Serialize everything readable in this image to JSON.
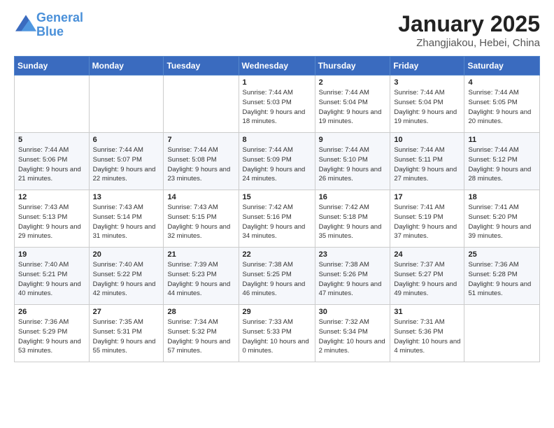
{
  "header": {
    "logo_line1": "General",
    "logo_line2": "Blue",
    "month": "January 2025",
    "location": "Zhangjiakou, Hebei, China"
  },
  "days_of_week": [
    "Sunday",
    "Monday",
    "Tuesday",
    "Wednesday",
    "Thursday",
    "Friday",
    "Saturday"
  ],
  "weeks": [
    [
      {
        "day": "",
        "sunrise": "",
        "sunset": "",
        "daylight": ""
      },
      {
        "day": "",
        "sunrise": "",
        "sunset": "",
        "daylight": ""
      },
      {
        "day": "",
        "sunrise": "",
        "sunset": "",
        "daylight": ""
      },
      {
        "day": "1",
        "sunrise": "Sunrise: 7:44 AM",
        "sunset": "Sunset: 5:03 PM",
        "daylight": "Daylight: 9 hours and 18 minutes."
      },
      {
        "day": "2",
        "sunrise": "Sunrise: 7:44 AM",
        "sunset": "Sunset: 5:04 PM",
        "daylight": "Daylight: 9 hours and 19 minutes."
      },
      {
        "day": "3",
        "sunrise": "Sunrise: 7:44 AM",
        "sunset": "Sunset: 5:04 PM",
        "daylight": "Daylight: 9 hours and 19 minutes."
      },
      {
        "day": "4",
        "sunrise": "Sunrise: 7:44 AM",
        "sunset": "Sunset: 5:05 PM",
        "daylight": "Daylight: 9 hours and 20 minutes."
      }
    ],
    [
      {
        "day": "5",
        "sunrise": "Sunrise: 7:44 AM",
        "sunset": "Sunset: 5:06 PM",
        "daylight": "Daylight: 9 hours and 21 minutes."
      },
      {
        "day": "6",
        "sunrise": "Sunrise: 7:44 AM",
        "sunset": "Sunset: 5:07 PM",
        "daylight": "Daylight: 9 hours and 22 minutes."
      },
      {
        "day": "7",
        "sunrise": "Sunrise: 7:44 AM",
        "sunset": "Sunset: 5:08 PM",
        "daylight": "Daylight: 9 hours and 23 minutes."
      },
      {
        "day": "8",
        "sunrise": "Sunrise: 7:44 AM",
        "sunset": "Sunset: 5:09 PM",
        "daylight": "Daylight: 9 hours and 24 minutes."
      },
      {
        "day": "9",
        "sunrise": "Sunrise: 7:44 AM",
        "sunset": "Sunset: 5:10 PM",
        "daylight": "Daylight: 9 hours and 26 minutes."
      },
      {
        "day": "10",
        "sunrise": "Sunrise: 7:44 AM",
        "sunset": "Sunset: 5:11 PM",
        "daylight": "Daylight: 9 hours and 27 minutes."
      },
      {
        "day": "11",
        "sunrise": "Sunrise: 7:44 AM",
        "sunset": "Sunset: 5:12 PM",
        "daylight": "Daylight: 9 hours and 28 minutes."
      }
    ],
    [
      {
        "day": "12",
        "sunrise": "Sunrise: 7:43 AM",
        "sunset": "Sunset: 5:13 PM",
        "daylight": "Daylight: 9 hours and 29 minutes."
      },
      {
        "day": "13",
        "sunrise": "Sunrise: 7:43 AM",
        "sunset": "Sunset: 5:14 PM",
        "daylight": "Daylight: 9 hours and 31 minutes."
      },
      {
        "day": "14",
        "sunrise": "Sunrise: 7:43 AM",
        "sunset": "Sunset: 5:15 PM",
        "daylight": "Daylight: 9 hours and 32 minutes."
      },
      {
        "day": "15",
        "sunrise": "Sunrise: 7:42 AM",
        "sunset": "Sunset: 5:16 PM",
        "daylight": "Daylight: 9 hours and 34 minutes."
      },
      {
        "day": "16",
        "sunrise": "Sunrise: 7:42 AM",
        "sunset": "Sunset: 5:18 PM",
        "daylight": "Daylight: 9 hours and 35 minutes."
      },
      {
        "day": "17",
        "sunrise": "Sunrise: 7:41 AM",
        "sunset": "Sunset: 5:19 PM",
        "daylight": "Daylight: 9 hours and 37 minutes."
      },
      {
        "day": "18",
        "sunrise": "Sunrise: 7:41 AM",
        "sunset": "Sunset: 5:20 PM",
        "daylight": "Daylight: 9 hours and 39 minutes."
      }
    ],
    [
      {
        "day": "19",
        "sunrise": "Sunrise: 7:40 AM",
        "sunset": "Sunset: 5:21 PM",
        "daylight": "Daylight: 9 hours and 40 minutes."
      },
      {
        "day": "20",
        "sunrise": "Sunrise: 7:40 AM",
        "sunset": "Sunset: 5:22 PM",
        "daylight": "Daylight: 9 hours and 42 minutes."
      },
      {
        "day": "21",
        "sunrise": "Sunrise: 7:39 AM",
        "sunset": "Sunset: 5:23 PM",
        "daylight": "Daylight: 9 hours and 44 minutes."
      },
      {
        "day": "22",
        "sunrise": "Sunrise: 7:38 AM",
        "sunset": "Sunset: 5:25 PM",
        "daylight": "Daylight: 9 hours and 46 minutes."
      },
      {
        "day": "23",
        "sunrise": "Sunrise: 7:38 AM",
        "sunset": "Sunset: 5:26 PM",
        "daylight": "Daylight: 9 hours and 47 minutes."
      },
      {
        "day": "24",
        "sunrise": "Sunrise: 7:37 AM",
        "sunset": "Sunset: 5:27 PM",
        "daylight": "Daylight: 9 hours and 49 minutes."
      },
      {
        "day": "25",
        "sunrise": "Sunrise: 7:36 AM",
        "sunset": "Sunset: 5:28 PM",
        "daylight": "Daylight: 9 hours and 51 minutes."
      }
    ],
    [
      {
        "day": "26",
        "sunrise": "Sunrise: 7:36 AM",
        "sunset": "Sunset: 5:29 PM",
        "daylight": "Daylight: 9 hours and 53 minutes."
      },
      {
        "day": "27",
        "sunrise": "Sunrise: 7:35 AM",
        "sunset": "Sunset: 5:31 PM",
        "daylight": "Daylight: 9 hours and 55 minutes."
      },
      {
        "day": "28",
        "sunrise": "Sunrise: 7:34 AM",
        "sunset": "Sunset: 5:32 PM",
        "daylight": "Daylight: 9 hours and 57 minutes."
      },
      {
        "day": "29",
        "sunrise": "Sunrise: 7:33 AM",
        "sunset": "Sunset: 5:33 PM",
        "daylight": "Daylight: 10 hours and 0 minutes."
      },
      {
        "day": "30",
        "sunrise": "Sunrise: 7:32 AM",
        "sunset": "Sunset: 5:34 PM",
        "daylight": "Daylight: 10 hours and 2 minutes."
      },
      {
        "day": "31",
        "sunrise": "Sunrise: 7:31 AM",
        "sunset": "Sunset: 5:36 PM",
        "daylight": "Daylight: 10 hours and 4 minutes."
      },
      {
        "day": "",
        "sunrise": "",
        "sunset": "",
        "daylight": ""
      }
    ]
  ]
}
